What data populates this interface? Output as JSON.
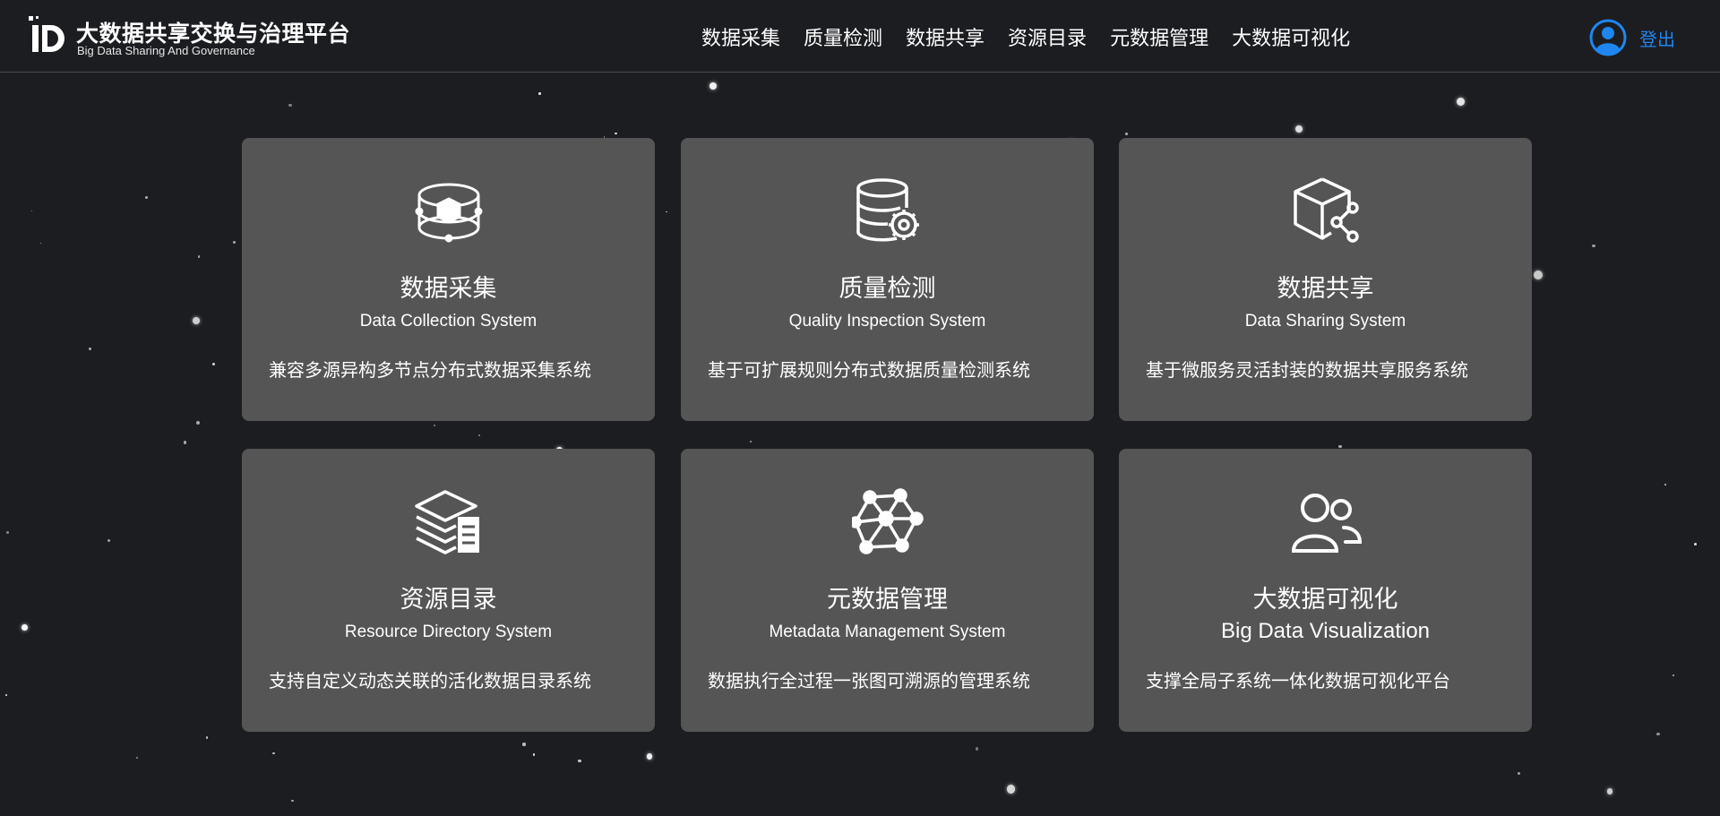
{
  "app": {
    "title": "大数据共享交换与治理平台",
    "subtitle": "Big Data Sharing And Governance"
  },
  "nav": {
    "items": [
      {
        "label": "数据采集"
      },
      {
        "label": "质量检测"
      },
      {
        "label": "数据共享"
      },
      {
        "label": "资源目录"
      },
      {
        "label": "元数据管理"
      },
      {
        "label": "大数据可视化"
      }
    ]
  },
  "user": {
    "logout_label": "登出"
  },
  "colors": {
    "background": "#1c1d21",
    "card": "#555555",
    "accent": "#1f86f0"
  },
  "cards": [
    {
      "icon": "data-collection-icon",
      "title": "数据采集",
      "subtitle": "Data Collection System",
      "desc": "兼容多源异构多节点分布式数据采集系统"
    },
    {
      "icon": "database-gear-icon",
      "title": "质量检测",
      "subtitle": "Quality Inspection System",
      "desc": "基于可扩展规则分布式数据质量检测系统"
    },
    {
      "icon": "box-share-icon",
      "title": "数据共享",
      "subtitle": "Data Sharing System",
      "desc": "基于微服务灵活封装的数据共享服务系统"
    },
    {
      "icon": "stacked-layers-icon",
      "title": "资源目录",
      "subtitle": "Resource Directory System",
      "desc": "支持自定义动态关联的活化数据目录系统"
    },
    {
      "icon": "network-graph-icon",
      "title": "元数据管理",
      "subtitle": "Metadata Management System",
      "desc": "数据执行全过程一张图可溯源的管理系统"
    },
    {
      "icon": "users-icon",
      "title": "大数据可视化",
      "subtitle": "Big Data Visualization",
      "desc": "支撑全局子系统一体化数据可视化平台"
    }
  ]
}
